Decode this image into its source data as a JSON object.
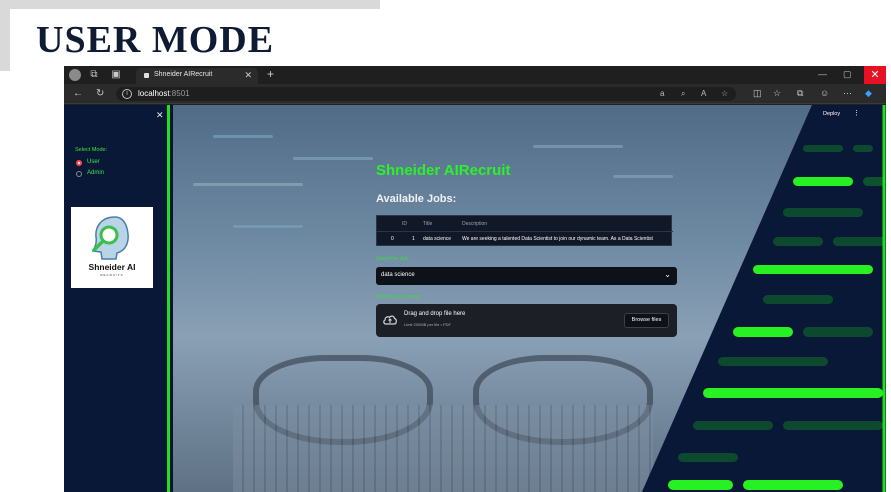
{
  "slide": {
    "title": "USER MODE"
  },
  "browser": {
    "tab_title": "Shneider AIRecruit",
    "url_host": "localhost",
    "url_port": ":8501"
  },
  "page": {
    "deploy_label": "Deploy",
    "sidebar": {
      "select_mode_label": "Select Mode:",
      "options": [
        {
          "label": "User",
          "selected": true
        },
        {
          "label": "Admin",
          "selected": false
        }
      ],
      "logo_text": "Shneider AI",
      "logo_sub": "RECRUITS"
    },
    "main": {
      "title": "Shneider AIRecruit",
      "jobs_heading": "Available Jobs:",
      "table": {
        "columns": [
          "",
          "ID",
          "Title",
          "Description"
        ],
        "rows": [
          [
            "0",
            "1",
            "data science",
            "We are seeking a talented Data Scientist to join our dynamic team. As a Data Scientist"
          ]
        ]
      },
      "select_label": "Select the Job:",
      "select_value": "data science",
      "upload_label": "Upload your resume",
      "dropzone_title": "Drag and drop file here",
      "dropzone_sub": "Limit 200MB per file • PDF",
      "browse_label": "Browse files"
    }
  },
  "colors": {
    "accent_green": "#22e01f",
    "sidebar_bg": "#0a1838",
    "radio_red": "#ff4b4b"
  }
}
